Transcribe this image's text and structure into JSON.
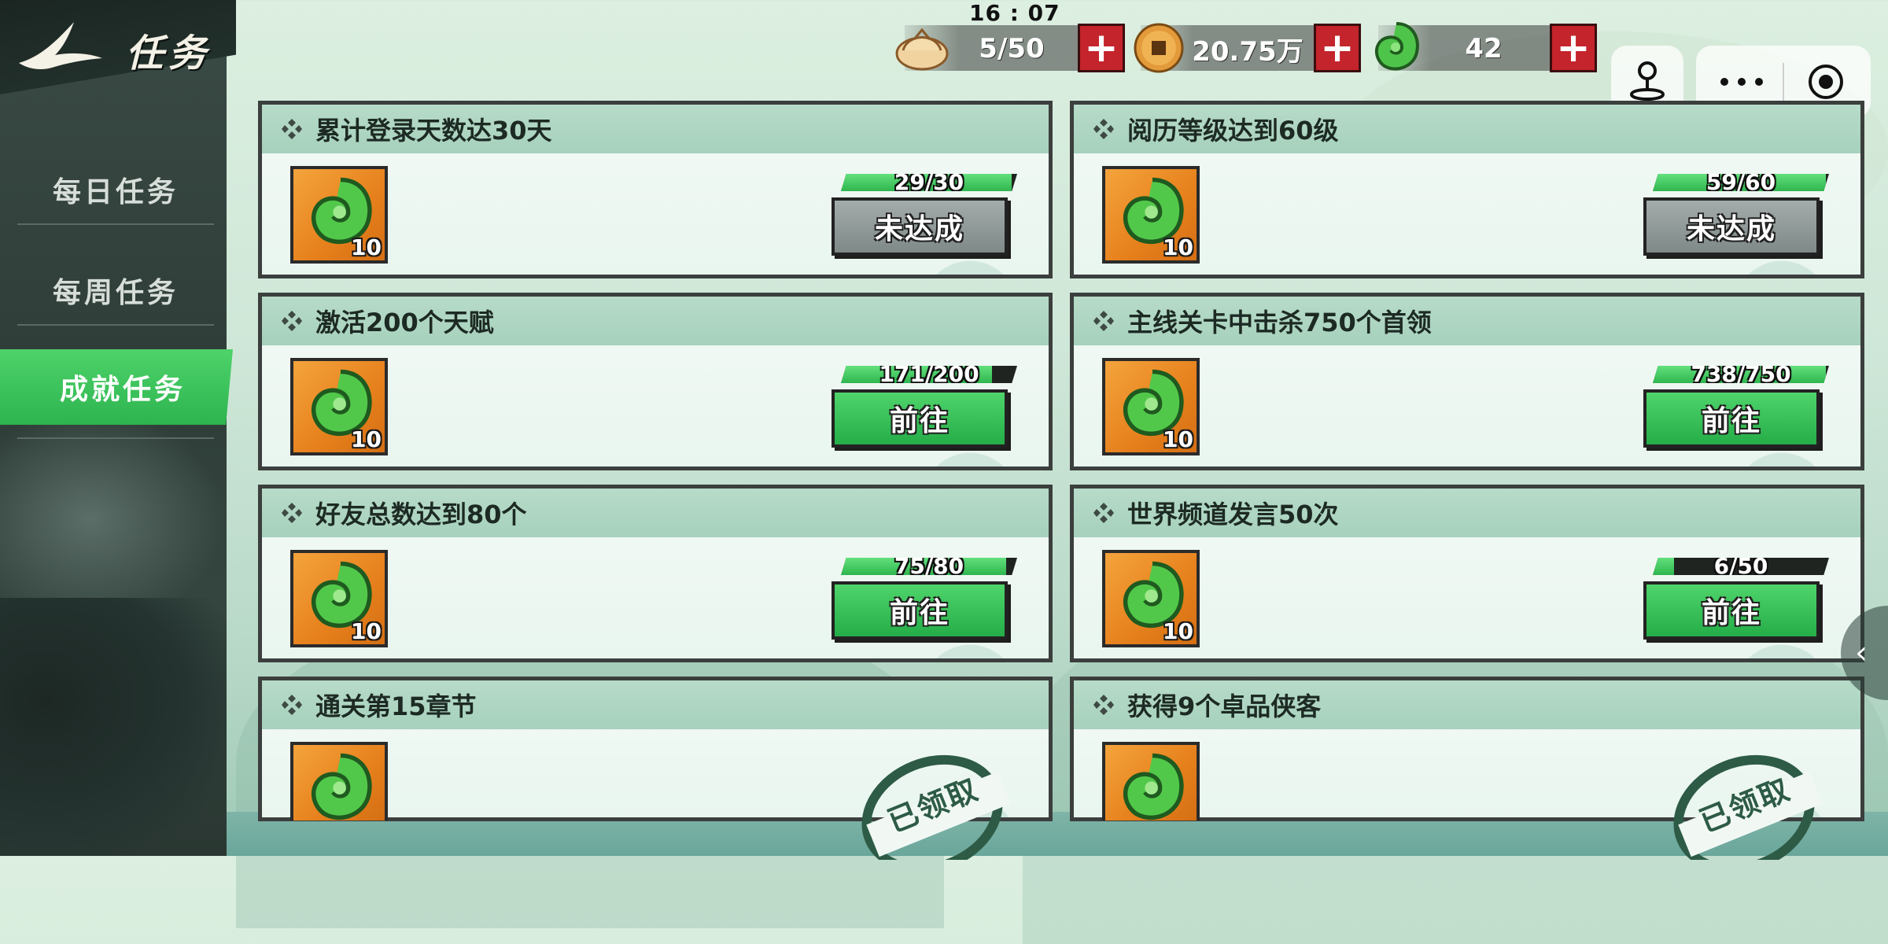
{
  "header": {
    "title": "任务",
    "time": "16 : 07"
  },
  "resources": {
    "stamina": "5/50",
    "coins": "20.75万",
    "jade": "42"
  },
  "sidebar": {
    "items": [
      {
        "label": "每日任务"
      },
      {
        "label": "每周任务"
      },
      {
        "label": "成就任务"
      }
    ]
  },
  "tasks": [
    {
      "title": "累计登录天数达30天",
      "reward_qty": "10",
      "progress_text": "29/30",
      "progress": 0.967,
      "button": "未达成",
      "state": "locked"
    },
    {
      "title": "阅历等级达到60级",
      "reward_qty": "10",
      "progress_text": "59/60",
      "progress": 0.983,
      "button": "未达成",
      "state": "locked"
    },
    {
      "title": "激活200个天赋",
      "reward_qty": "10",
      "progress_text": "171/200",
      "progress": 0.855,
      "button": "前往",
      "state": "go"
    },
    {
      "title": "主线关卡中击杀750个首领",
      "reward_qty": "10",
      "progress_text": "738/750",
      "progress": 0.984,
      "button": "前往",
      "state": "go"
    },
    {
      "title": "好友总数达到80个",
      "reward_qty": "10",
      "progress_text": "75/80",
      "progress": 0.9375,
      "button": "前往",
      "state": "go"
    },
    {
      "title": "世界频道发言50次",
      "reward_qty": "10",
      "progress_text": "6/50",
      "progress": 0.12,
      "button": "前往",
      "state": "go"
    },
    {
      "title": "通关第15章节",
      "stamp": "已领取",
      "state": "claimed"
    },
    {
      "title": "获得9个卓品侠客",
      "stamp": "已领取",
      "state": "claimed"
    }
  ],
  "colors": {
    "accent_green": "#2db44f",
    "plus_red": "#c4242c",
    "reward_orange": "#e6801c"
  },
  "icons": [
    "swallow-logo-icon",
    "bun-icon",
    "coin-icon",
    "jade-icon",
    "plus-icon",
    "joystick-icon",
    "more-icon",
    "record-icon",
    "diamond-bullet-icon",
    "chevron-left-icon"
  ]
}
